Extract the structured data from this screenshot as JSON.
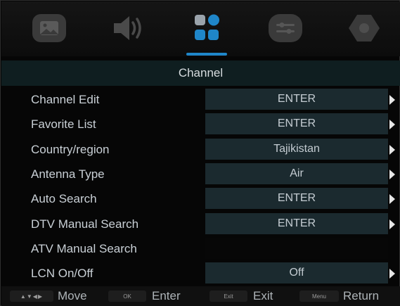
{
  "tabs": [
    {
      "icon": "picture-icon",
      "selected": false
    },
    {
      "icon": "sound-icon",
      "selected": false
    },
    {
      "icon": "channel-icon",
      "selected": true
    },
    {
      "icon": "settings-icon",
      "selected": false
    },
    {
      "icon": "lock-icon",
      "selected": false
    }
  ],
  "menu": {
    "title": "Channel",
    "rows": [
      {
        "label": "Channel Edit",
        "value": "ENTER"
      },
      {
        "label": "Favorite List",
        "value": "ENTER"
      },
      {
        "label": "Country/region",
        "value": "Tajikistan"
      },
      {
        "label": "Antenna Type",
        "value": "Air"
      },
      {
        "label": "Auto Search",
        "value": "ENTER"
      },
      {
        "label": "DTV Manual Search",
        "value": "ENTER"
      },
      {
        "label": "ATV Manual Search",
        "value": ""
      },
      {
        "label": "LCN On/Off",
        "value": "Off"
      }
    ]
  },
  "help": {
    "nav_key": "▲▼◀▶",
    "move": "Move",
    "ok_key": "OK",
    "enter": "Enter",
    "exit_key": "Exit",
    "exit": "Exit",
    "menu_key": "Menu",
    "return": "Return"
  },
  "colors": {
    "accent": "#1f86c9",
    "value_bg": "#1b2a2f",
    "title_bg": "#0f1e20"
  }
}
